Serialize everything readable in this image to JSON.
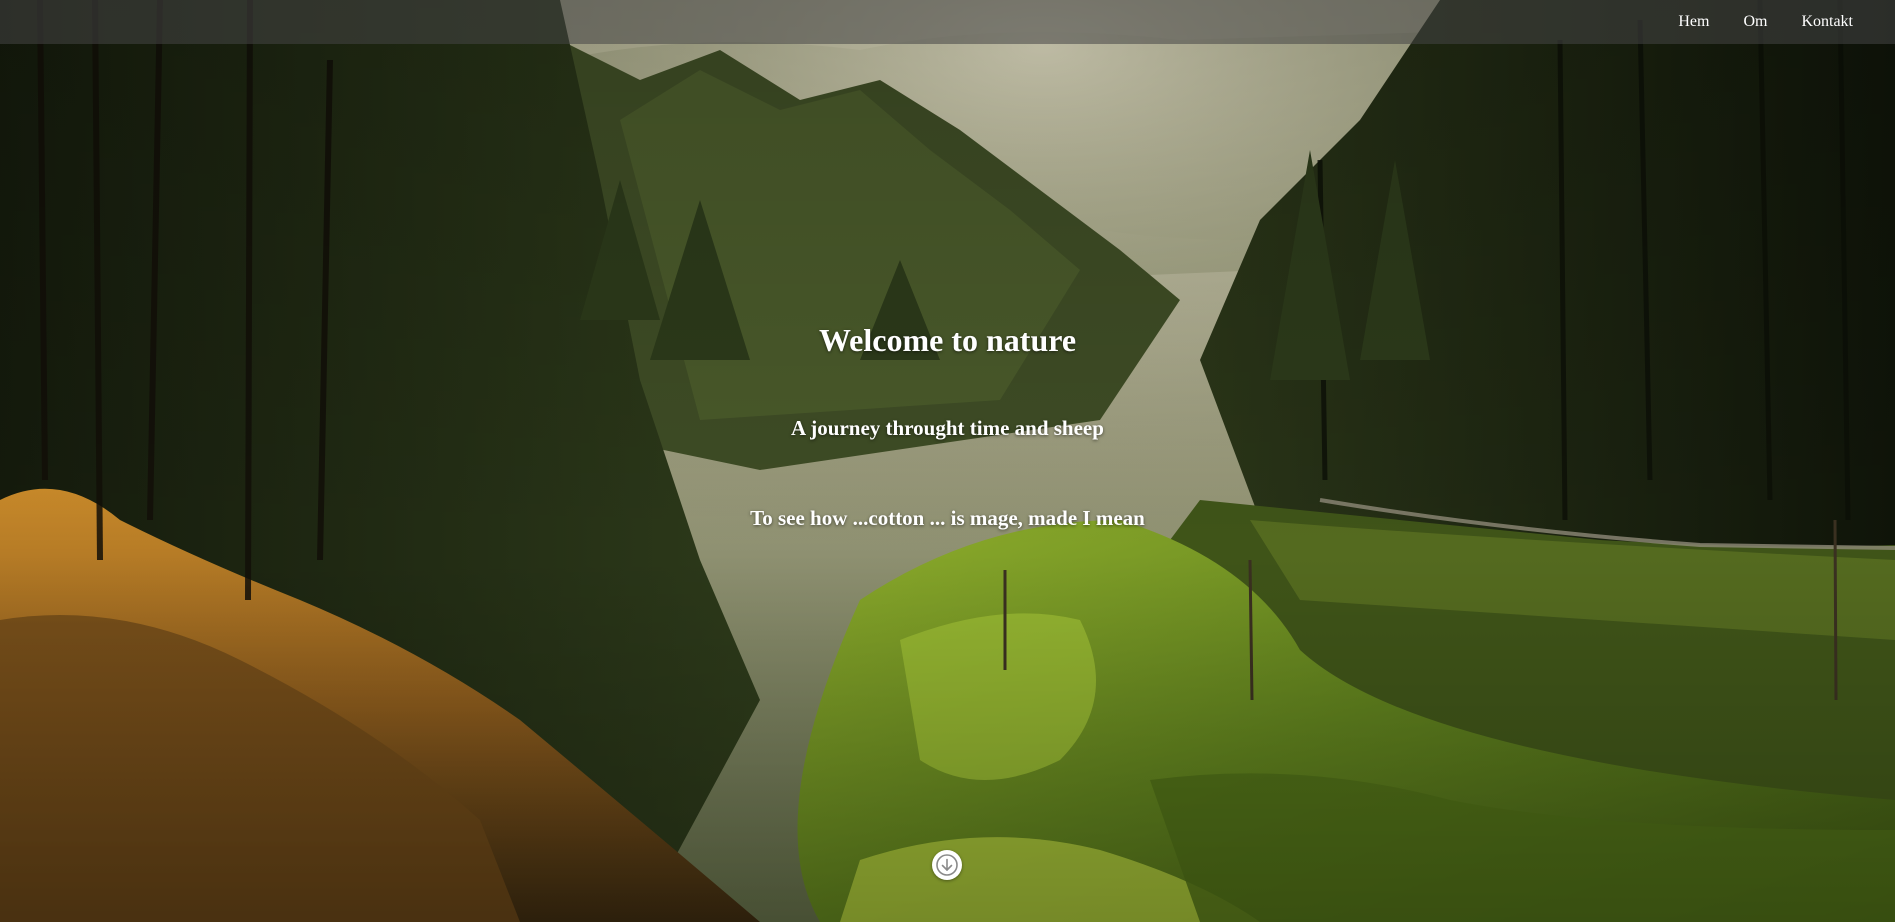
{
  "nav": {
    "items": [
      {
        "label": "Hem"
      },
      {
        "label": "Om"
      },
      {
        "label": "Kontakt"
      }
    ]
  },
  "hero": {
    "title": "Welcome to nature",
    "subtitle": "A journey throught time and sheep",
    "tagline": "To see how ...cotton ... is mage, made I mean",
    "background": "forest-valley-photo",
    "scroll_icon": "arrow-down-icon"
  },
  "colors": {
    "text": "#ffffff",
    "navbar": "#464646",
    "scroll_button": "#ffffff"
  }
}
